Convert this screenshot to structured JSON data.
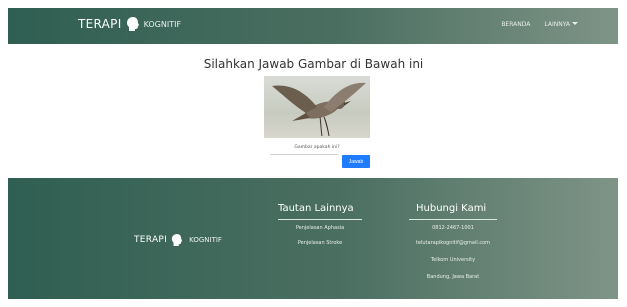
{
  "navbar": {
    "brand_text": "TERAPI",
    "brand_suffix": "KOGNITIF",
    "nav_home": "BERANDA",
    "nav_other": "LAINNYA"
  },
  "main": {
    "title": "Silahkan Jawab Gambar di Bawah ini",
    "question": "Gambar apakah ini?",
    "answer_label": "Jawab",
    "answer_value": ""
  },
  "footer": {
    "brand_text": "TERAPI",
    "brand_suffix": "KOGNITIF",
    "tautan_title": "Tautan Lainnya",
    "tautan_items": [
      "Penjelasan Aphasia",
      "Penjelasan Stroke"
    ],
    "hubungi_title": "Hubungi Kami",
    "hubungi_items": [
      "0812-2467-1001",
      "telutarapikognitif@gmail.com",
      "Telkom University",
      "Bandung, Jawa Barat"
    ]
  },
  "colors": {
    "primary": "#3e6a5c",
    "accent_blue": "#1f7cff"
  },
  "icons": [
    "head-silhouette-icon",
    "caret-down-icon"
  ]
}
